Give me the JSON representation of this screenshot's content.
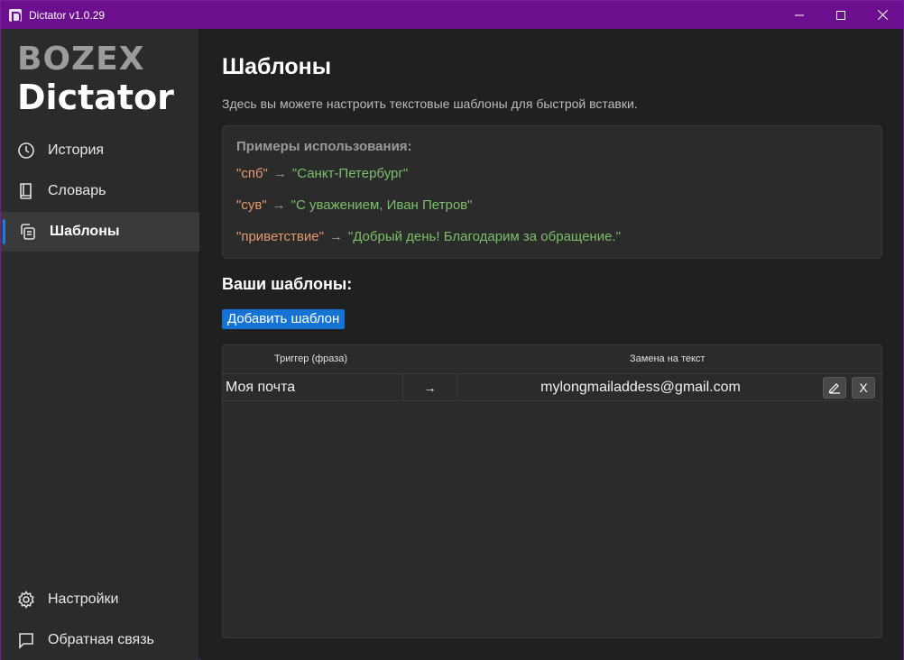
{
  "window": {
    "title": "Dictator v1.0.29"
  },
  "sidebar": {
    "logo_top": "BOZEX",
    "logo_bottom": "Dictator",
    "items": [
      {
        "label": "История",
        "icon": "clock-icon",
        "active": false
      },
      {
        "label": "Словарь",
        "icon": "book-icon",
        "active": false
      },
      {
        "label": "Шаблоны",
        "icon": "templates-icon",
        "active": true
      }
    ],
    "bottom_items": [
      {
        "label": "Настройки",
        "icon": "gear-icon"
      },
      {
        "label": "Обратная связь",
        "icon": "feedback-icon"
      }
    ]
  },
  "main": {
    "title": "Шаблоны",
    "subtitle": "Здесь вы можете настроить текстовые шаблоны для быстрой вставки.",
    "examples": {
      "title": "Примеры использования:",
      "arrow": "→",
      "items": [
        {
          "trigger": "\"спб\"",
          "value": "\"Санкт-Петербург\""
        },
        {
          "trigger": "\"сув\"",
          "value": "\"С уважением, Иван Петров\""
        },
        {
          "trigger": "\"приветствие\"",
          "value": "\"Добрый день! Благодарим за обращение.\""
        }
      ]
    },
    "section_title": "Ваши шаблоны:",
    "add_button": "Добавить шаблон",
    "table": {
      "headers": [
        "Триггер (фраза)",
        "Замена на текст"
      ],
      "rows": [
        {
          "trigger": "Моя почта",
          "arrow": "→",
          "value": "mylongmailaddess@gmail.com",
          "edit_icon": "pencil-icon",
          "delete_label": "X"
        }
      ]
    }
  },
  "colors": {
    "titlebar": "#6b0f8f",
    "accent": "#1673d6",
    "trigger": "#e59a6e",
    "value": "#7bbf6a"
  }
}
